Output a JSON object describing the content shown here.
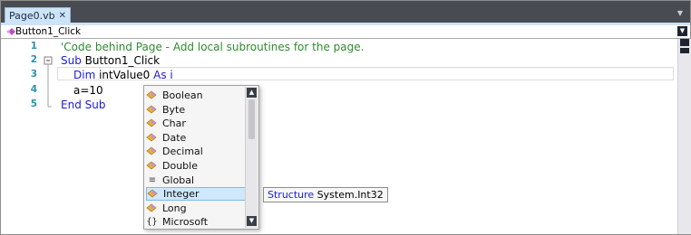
{
  "tab": {
    "title": "Page0.vb",
    "close": "✕"
  },
  "member_dropdown": {
    "selected": "Button1_Click"
  },
  "editor": {
    "lines": [
      {
        "no": "1",
        "text": "'Code behind Page - Add local subroutines for the page."
      },
      {
        "no": "2",
        "kw1": "Sub",
        "text": " Button1_Click"
      },
      {
        "no": "3",
        "kw1": "Dim",
        "text": " intValue0 ",
        "kw2": "As",
        "tail": " i"
      },
      {
        "no": "4",
        "text": "a=10"
      },
      {
        "no": "5",
        "kw1": "End Sub"
      }
    ]
  },
  "intellisense": {
    "items": [
      {
        "label": "Boolean",
        "icon": "structure-icon"
      },
      {
        "label": "Byte",
        "icon": "structure-icon"
      },
      {
        "label": "Char",
        "icon": "structure-icon"
      },
      {
        "label": "Date",
        "icon": "structure-icon"
      },
      {
        "label": "Decimal",
        "icon": "structure-icon"
      },
      {
        "label": "Double",
        "icon": "structure-icon"
      },
      {
        "label": "Global",
        "icon": "keyword-icon"
      },
      {
        "label": "Integer",
        "icon": "structure-icon"
      },
      {
        "label": "Long",
        "icon": "structure-icon"
      },
      {
        "label": "Microsoft",
        "icon": "namespace-icon"
      }
    ],
    "selected_index": 7
  },
  "tooltip": {
    "kind": "Structure",
    "type": "System.Int32"
  },
  "colors": {
    "keyword": "#1b1bd4",
    "comment": "#2e8b2e",
    "line_number": "#2b91af",
    "selection": "#cfe8fc"
  }
}
